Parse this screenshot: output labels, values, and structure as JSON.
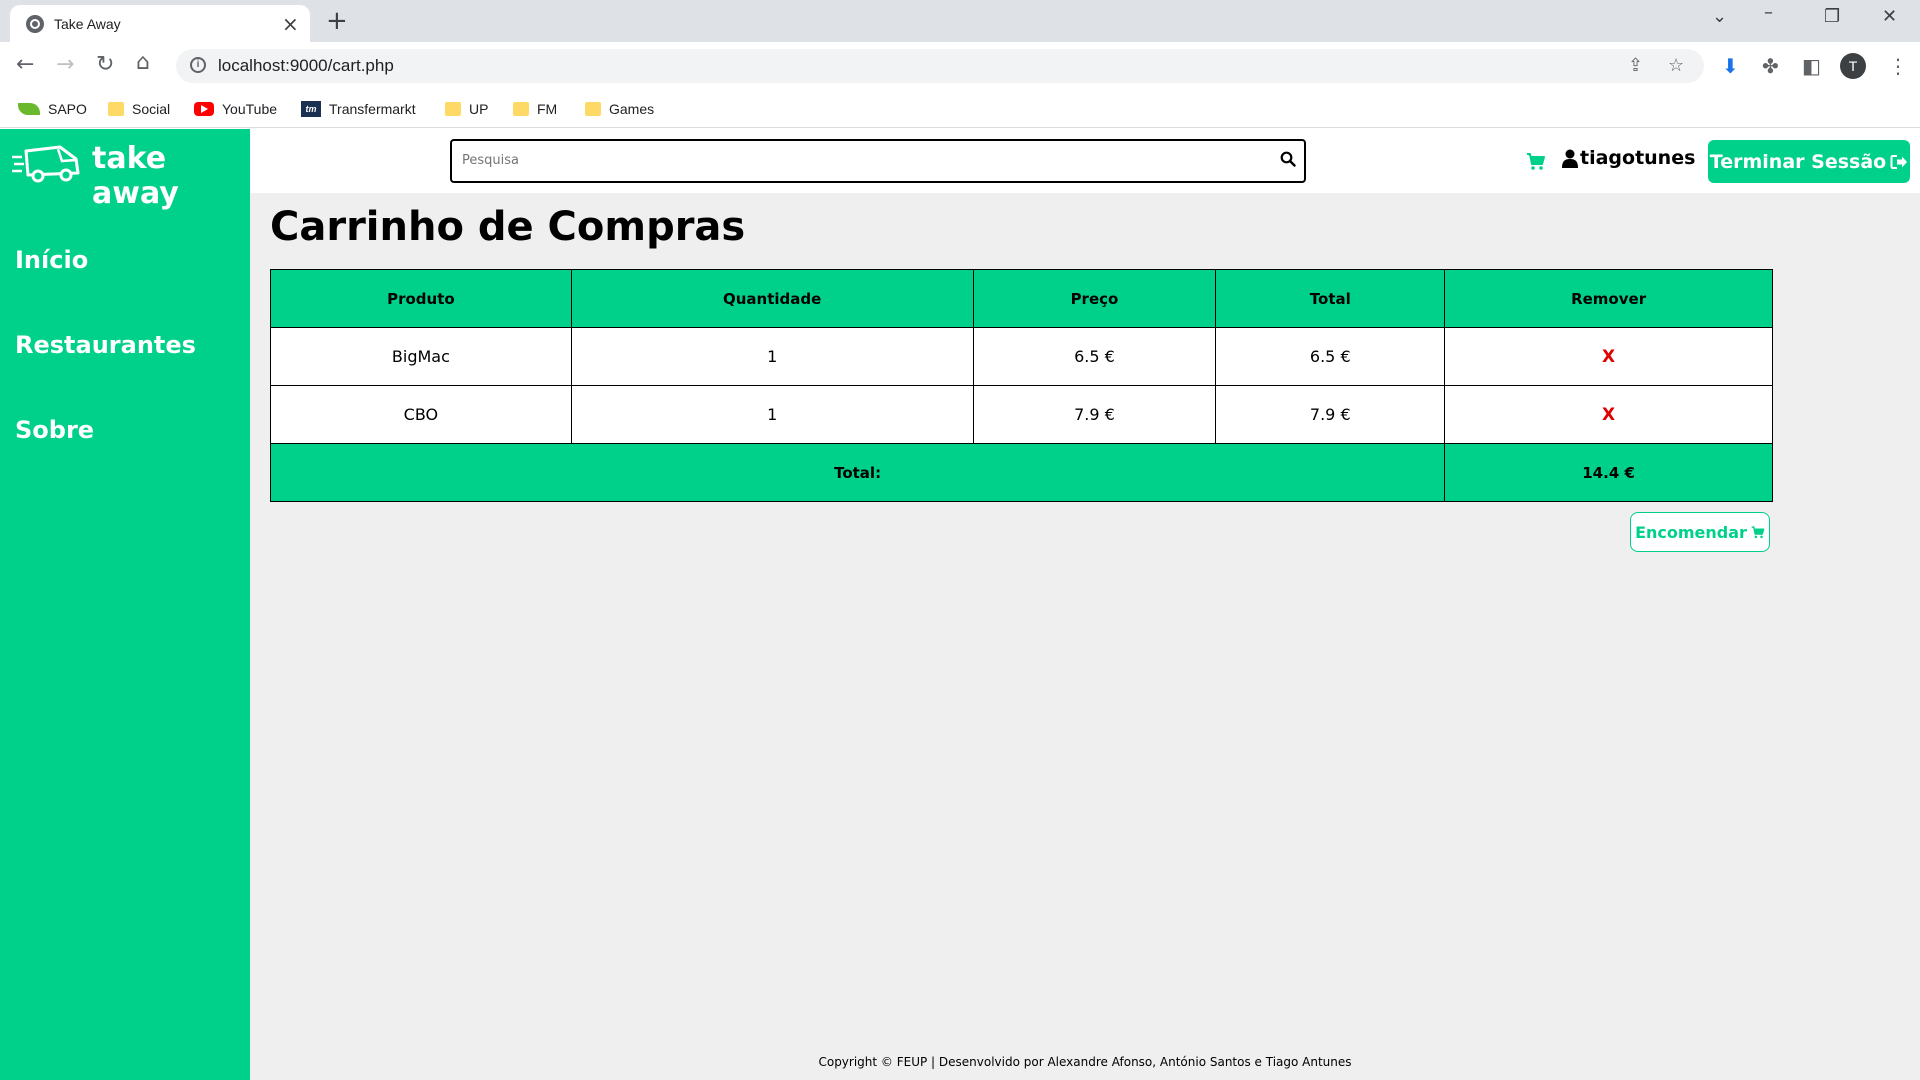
{
  "browser": {
    "tab_title": "Take Away",
    "url": "localhost:9000/cart.php",
    "profile_initial": "T",
    "bookmarks": [
      "SAPO",
      "Social",
      "YouTube",
      "Transfermarkt",
      "UP",
      "FM",
      "Games"
    ]
  },
  "sidebar": {
    "logo_text": "take away",
    "items": [
      "Início",
      "Restaurantes",
      "Sobre"
    ]
  },
  "topbar": {
    "search_placeholder": "Pesquisa",
    "username": "tiagotunes",
    "logout_label": "Terminar Sessão"
  },
  "cart": {
    "title": "Carrinho de Compras",
    "headers": [
      "Produto",
      "Quantidade",
      "Preço",
      "Total",
      "Remover"
    ],
    "rows": [
      {
        "product": "BigMac",
        "quantity": "1",
        "price": "6.5 €",
        "total": "6.5 €",
        "remove": "X"
      },
      {
        "product": "CBO",
        "quantity": "1",
        "price": "7.9 €",
        "total": "7.9 €",
        "remove": "X"
      }
    ],
    "total_label": "Total:",
    "total_value": "14.4 €",
    "order_label": "Encomendar"
  },
  "footer": {
    "text": "Copyright © FEUP | Desenvolvido por Alexandre Afonso, António Santos e Tiago Antunes"
  },
  "colors": {
    "brand_green": "#00d18a",
    "remove_red": "#e00000"
  }
}
